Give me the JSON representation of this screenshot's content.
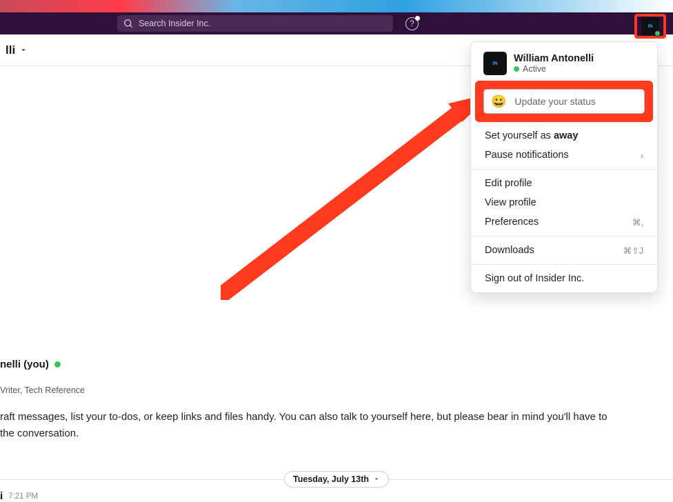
{
  "search": {
    "placeholder": "Search Insider Inc."
  },
  "channel_header": {
    "name_fragment": "lli"
  },
  "user_menu": {
    "name": "William Antonelli",
    "presence": "Active",
    "status_placeholder": "Update your status",
    "set_away_prefix": "Set yourself as ",
    "set_away_bold": "away",
    "pause_notifications": "Pause notifications",
    "edit_profile": "Edit profile",
    "view_profile": "View profile",
    "preferences": "Preferences",
    "preferences_shortcut": "⌘,",
    "downloads": "Downloads",
    "downloads_shortcut": "⌘⇧J",
    "sign_out": "Sign out of Insider Inc."
  },
  "self_section": {
    "name_fragment": "nelli (you)",
    "title_fragment": "Vriter, Tech Reference",
    "desc_line1": "raft messages, list your to-dos, or keep links and files handy. You can also talk to yourself here, but please bear in mind you'll have to",
    "desc_line2": "the conversation."
  },
  "date_divider": "Tuesday, July 13th",
  "message": {
    "name_fragment": "i",
    "time": "7:21 PM"
  }
}
